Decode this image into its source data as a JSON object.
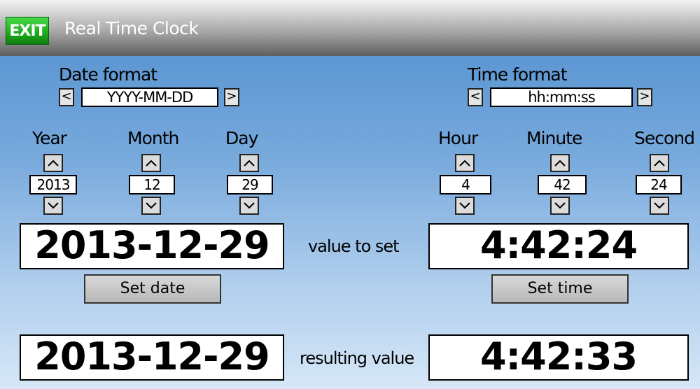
{
  "titlebar": {
    "exit_label": "EXIT",
    "title": "Real Time Clock"
  },
  "date_format": {
    "label": "Date format",
    "value": "YYYY-MM-DD"
  },
  "time_format": {
    "label": "Time format",
    "value": "hh:mm:ss"
  },
  "fields": {
    "year": {
      "label": "Year",
      "value": "2013"
    },
    "month": {
      "label": "Month",
      "value": "12"
    },
    "day": {
      "label": "Day",
      "value": "29"
    },
    "hour": {
      "label": "Hour",
      "value": "4"
    },
    "minute": {
      "label": "Minute",
      "value": "42"
    },
    "second": {
      "label": "Second",
      "value": "24"
    }
  },
  "set": {
    "label": "value to set",
    "date": "2013-12-29",
    "time": "4:42:24"
  },
  "buttons": {
    "set_date": "Set date",
    "set_time": "Set time"
  },
  "result": {
    "label": "resulting value",
    "date": "2013-12-29",
    "time": "4:42:33"
  },
  "icons": {
    "left": "<",
    "right": ">"
  },
  "colors": {
    "exit_green": "#1da91d",
    "background_top": "#4d8ccd",
    "background_bottom": "#d6e7f7"
  }
}
